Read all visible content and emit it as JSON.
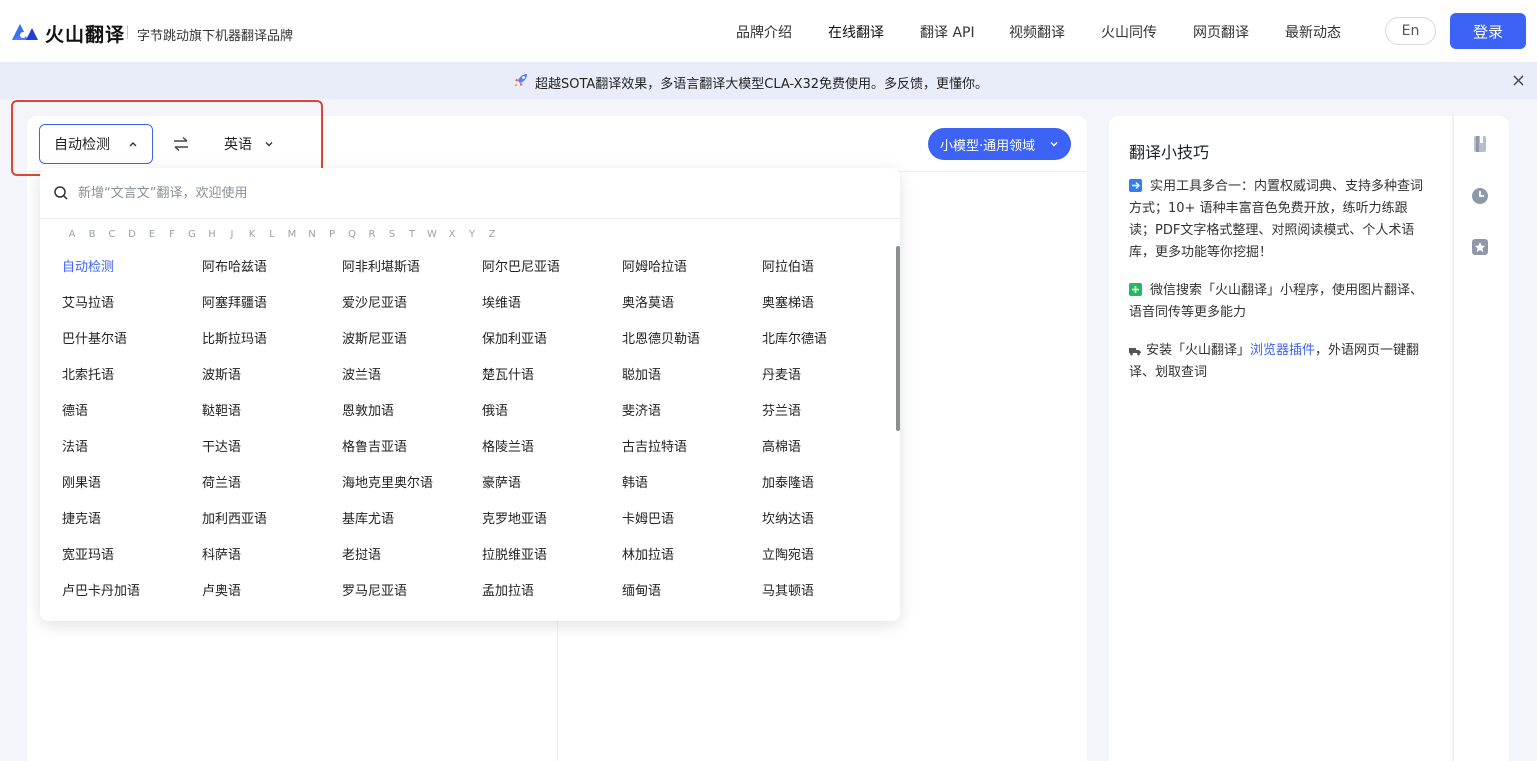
{
  "header": {
    "brand_name": "火山翻译",
    "brand_subtitle": "字节跳动旗下机器翻译品牌",
    "nav": [
      "品牌介绍",
      "在线翻译",
      "翻译 API",
      "视频翻译",
      "火山同传",
      "网页翻译",
      "最新动态"
    ],
    "active_nav": "在线翻译",
    "lang_toggle": "En",
    "login_label": "登录"
  },
  "banner": {
    "text": "超越SOTA翻译效果，多语言翻译大模型CLA-X32免费使用。多反馈，更懂你。"
  },
  "translator": {
    "source_lang": "自动检测",
    "target_lang": "英语",
    "model_label": "小模型·通用领域"
  },
  "dropdown": {
    "search_placeholder": "新增“文言文”翻译，欢迎使用",
    "alphabet": [
      "A",
      "B",
      "C",
      "D",
      "E",
      "F",
      "G",
      "H",
      "J",
      "K",
      "L",
      "M",
      "N",
      "P",
      "Q",
      "R",
      "S",
      "T",
      "W",
      "X",
      "Y",
      "Z"
    ],
    "selected": "自动检测",
    "languages": [
      "自动检测",
      "阿布哈兹语",
      "阿非利堪斯语",
      "阿尔巴尼亚语",
      "阿姆哈拉语",
      "阿拉伯语",
      "艾马拉语",
      "阿塞拜疆语",
      "爱沙尼亚语",
      "埃维语",
      "奥洛莫语",
      "奥塞梯语",
      "巴什基尔语",
      "比斯拉玛语",
      "波斯尼亚语",
      "保加利亚语",
      "北恩德贝勒语",
      "北库尔德语",
      "北索托语",
      "波斯语",
      "波兰语",
      "楚瓦什语",
      "聪加语",
      "丹麦语",
      "德语",
      "鞑靼语",
      "恩敦加语",
      "俄语",
      "斐济语",
      "芬兰语",
      "法语",
      "干达语",
      "格鲁吉亚语",
      "格陵兰语",
      "古吉拉特语",
      "高棉语",
      "刚果语",
      "荷兰语",
      "海地克里奥尔语",
      "豪萨语",
      "韩语",
      "加泰隆语",
      "捷克语",
      "加利西亚语",
      "基库尤语",
      "克罗地亚语",
      "卡姆巴语",
      "坎纳达语",
      "宽亚玛语",
      "科萨语",
      "老挝语",
      "拉脱维亚语",
      "林加拉语",
      "立陶宛语",
      "卢巴卡丹加语",
      "卢奥语",
      "罗马尼亚语",
      "孟加拉语",
      "缅甸语",
      "马其顿语"
    ]
  },
  "tips": {
    "title": "翻译小技巧",
    "tip1": "实用工具多合一：内置权威词典、支持多种查词方式；10+ 语种丰富音色免费开放，练听力练跟读；PDF文字格式整理、对照阅读模式、个人术语库，更多功能等你挖掘！",
    "tip2": "微信搜索「火山翻译」小程序，使用图片翻译、语音同传等更多能力",
    "tip3_prefix": "安装「火山翻译」",
    "tip3_link": "浏览器插件",
    "tip3_suffix": "，外语网页一键翻译、划取查词"
  },
  "colors": {
    "accent": "#3c63f6",
    "highlight_box": "#e0452f",
    "banner_bg": "#e9edf9",
    "page_bg": "#f3f5fa"
  },
  "icons": [
    "logo-icon",
    "rocket-icon",
    "close-icon",
    "chevron-up-icon",
    "swap-icon",
    "chevron-down-icon",
    "search-icon",
    "book-icon",
    "history-icon",
    "star-icon"
  ]
}
